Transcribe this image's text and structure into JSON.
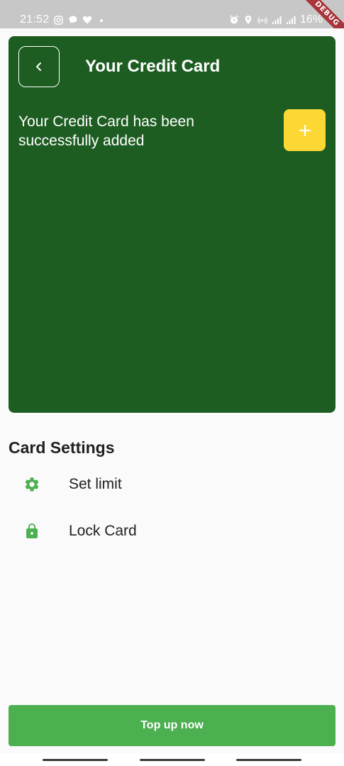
{
  "status_bar": {
    "time": "21:52",
    "battery": "16%",
    "left_icons": [
      "instagram-icon",
      "chat-bubble-icon",
      "heart-icon",
      "dot-icon"
    ],
    "right_icons": [
      "alarm-icon",
      "location-icon",
      "hotspot-icon",
      "signal-icon",
      "4g-signal-icon"
    ],
    "debug_label": "DEBUG"
  },
  "header": {
    "title": "Your Credit Card",
    "back_icon": "chevron-left-icon"
  },
  "card_panel": {
    "message": "Your Credit Card has been\n successfully added",
    "add_icon": "plus-icon",
    "background_color": "#1e5d22",
    "add_button_color": "#fdd835"
  },
  "settings": {
    "title": "Card Settings",
    "items": [
      {
        "label": "Set limit",
        "icon": "gear-icon"
      },
      {
        "label": "Lock Card",
        "icon": "lock-icon"
      }
    ],
    "icon_color": "#4caf50"
  },
  "footer": {
    "button_label": "Top up now",
    "button_color": "#4caf50"
  }
}
